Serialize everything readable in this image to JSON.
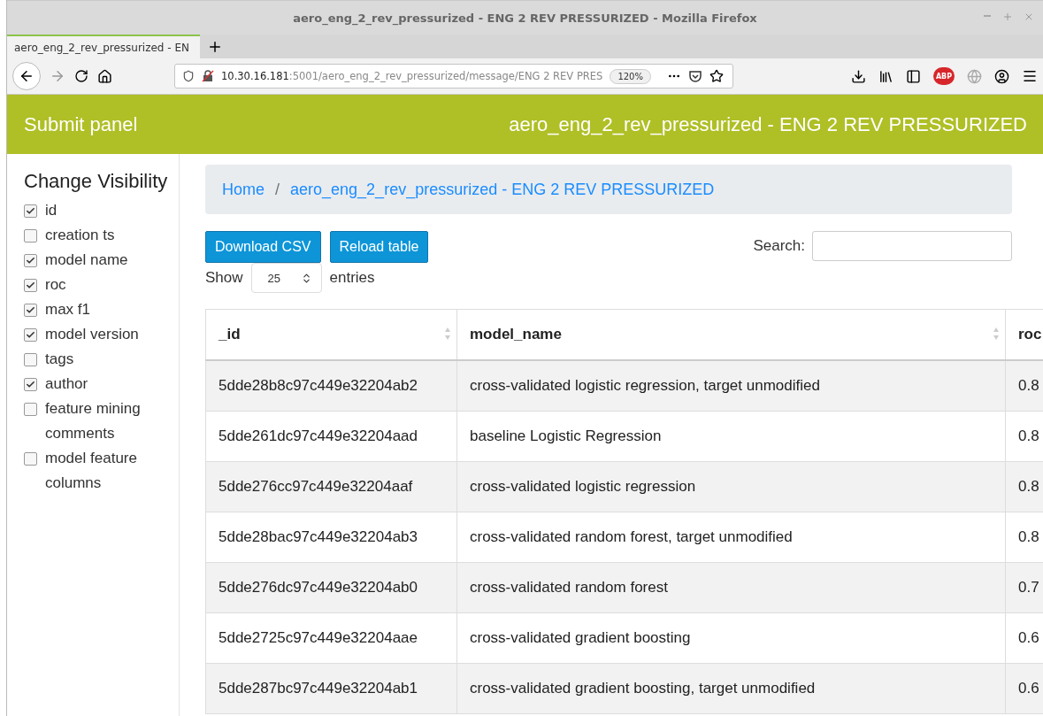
{
  "window": {
    "title": "aero_eng_2_rev_pressurized - ENG 2 REV PRESSURIZED - Mozilla Firefox"
  },
  "tabs": [
    {
      "label": "aero_eng_2_rev_pressurized - EN",
      "selected": true
    }
  ],
  "address_bar": {
    "host": "10.30.16.181",
    "rest": ":5001/aero_eng_2_rev_pressurized/message/ENG 2 REV PRES",
    "zoom": "120%"
  },
  "header": {
    "brand": "Submit panel",
    "title": "aero_eng_2_rev_pressurized - ENG 2 REV PRESSURIZED"
  },
  "sidebar": {
    "title": "Change Visibility",
    "items": [
      {
        "label": "id",
        "checked": true
      },
      {
        "label": "creation ts",
        "checked": false
      },
      {
        "label": "model name",
        "checked": true
      },
      {
        "label": "roc",
        "checked": true
      },
      {
        "label": "max f1",
        "checked": true
      },
      {
        "label": "model version",
        "checked": true
      },
      {
        "label": "tags",
        "checked": false
      },
      {
        "label": "author",
        "checked": true
      },
      {
        "label": "feature mining comments",
        "checked": false
      },
      {
        "label": "model feature columns",
        "checked": false
      }
    ]
  },
  "breadcrumb": [
    "Home",
    "aero_eng_2_rev_pressurized - ENG 2 REV PRESSURIZED"
  ],
  "breadcrumb_separator": "/",
  "adblock_badge": "ABP",
  "buttons": [
    "Download CSV",
    "Reload table"
  ],
  "search": {
    "label": "Search:"
  },
  "entries": {
    "before": "Show",
    "value": "25",
    "after": "entries"
  },
  "table": {
    "columns": [
      "_id",
      "model_name",
      "roc"
    ],
    "rows": [
      [
        "5dde28b8c97c449e32204ab2",
        "cross-validated logistic regression, target unmodified",
        "0.8"
      ],
      [
        "5dde261dc97c449e32204aad",
        "baseline Logistic Regression",
        "0.8"
      ],
      [
        "5dde276cc97c449e32204aaf",
        "cross-validated logistic regression",
        "0.8"
      ],
      [
        "5dde28bac97c449e32204ab3",
        "cross-validated random forest, target unmodified",
        "0.8"
      ],
      [
        "5dde276dc97c449e32204ab0",
        "cross-validated random forest",
        "0.7"
      ],
      [
        "5dde2725c97c449e32204aae",
        "cross-validated gradient boosting",
        "0.6"
      ],
      [
        "5dde287bc97c449e32204ab1",
        "cross-validated gradient boosting, target unmodified",
        "0.6"
      ]
    ]
  }
}
